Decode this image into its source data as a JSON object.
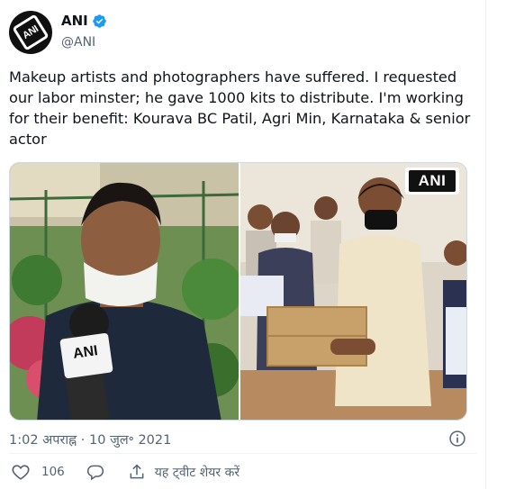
{
  "user": {
    "display_name": "ANI",
    "handle": "@ANI",
    "avatar_text": "ANI",
    "verified": true
  },
  "tweet": {
    "text": "Makeup artists and photographers have suffered. I requested our labor minster; he gave 1000 kits to distribute. I'm working for their benefit: Kourava BC Patil, Agri Min, Karnataka & senior actor",
    "timestamp": "1:02 अपराह्न · 10 जुल॰ 2021",
    "media": {
      "watermark": "ANI",
      "mic_label": "ANI"
    }
  },
  "actions": {
    "like_count": "106",
    "share_label": "यह ट्वीट शेयर करें"
  },
  "colors": {
    "verified": "#1d9bf0",
    "muted_text": "#536471",
    "primary_text": "#0f1419",
    "border": "#cfd9de"
  },
  "icons": [
    "verified-badge-icon",
    "info-icon",
    "heart-icon",
    "reply-icon",
    "share-icon"
  ]
}
